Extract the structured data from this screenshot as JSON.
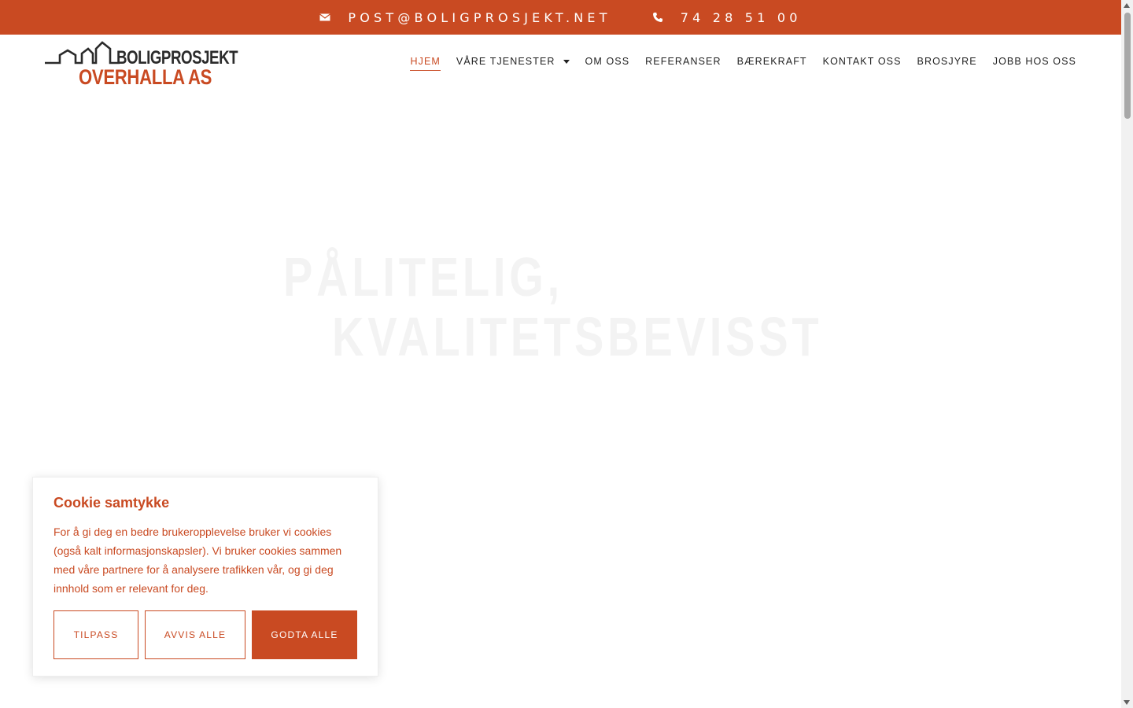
{
  "brand_color": "#c94a22",
  "topbar": {
    "email_icon": "envelope-icon",
    "email": "POST@BOLIGPROSJEKT.NET",
    "phone_icon": "phone-icon",
    "phone": "74 28 51 00"
  },
  "logo": {
    "line1": "BOLIGPROSJEKT",
    "line2": "OVERHALLA AS"
  },
  "nav": {
    "items": [
      {
        "label": "HJEM",
        "active": true
      },
      {
        "label": "VÅRE TJENESTER",
        "has_dropdown": true
      },
      {
        "label": "OM OSS"
      },
      {
        "label": "REFERANSER"
      },
      {
        "label": "BÆREKRAFT"
      },
      {
        "label": "KONTAKT OSS"
      },
      {
        "label": "BROSJYRE"
      },
      {
        "label": "JOBB HOS OSS"
      }
    ]
  },
  "hero": {
    "line1": "PÅLITELIG,",
    "line2": "KVALITETSBEVISST"
  },
  "cookie": {
    "title": "Cookie samtykke",
    "body": "For å gi deg en bedre brukeropplevelse bruker vi cookies (også kalt informasjonskapsler). Vi bruker cookies sammen med våre partnere for å analysere trafikken vår, og gi deg innhold som er relevant for deg.",
    "buttons": {
      "customize": "TILPASS",
      "reject": "AVVIS ALLE",
      "accept": "GODTA ALLE"
    }
  }
}
